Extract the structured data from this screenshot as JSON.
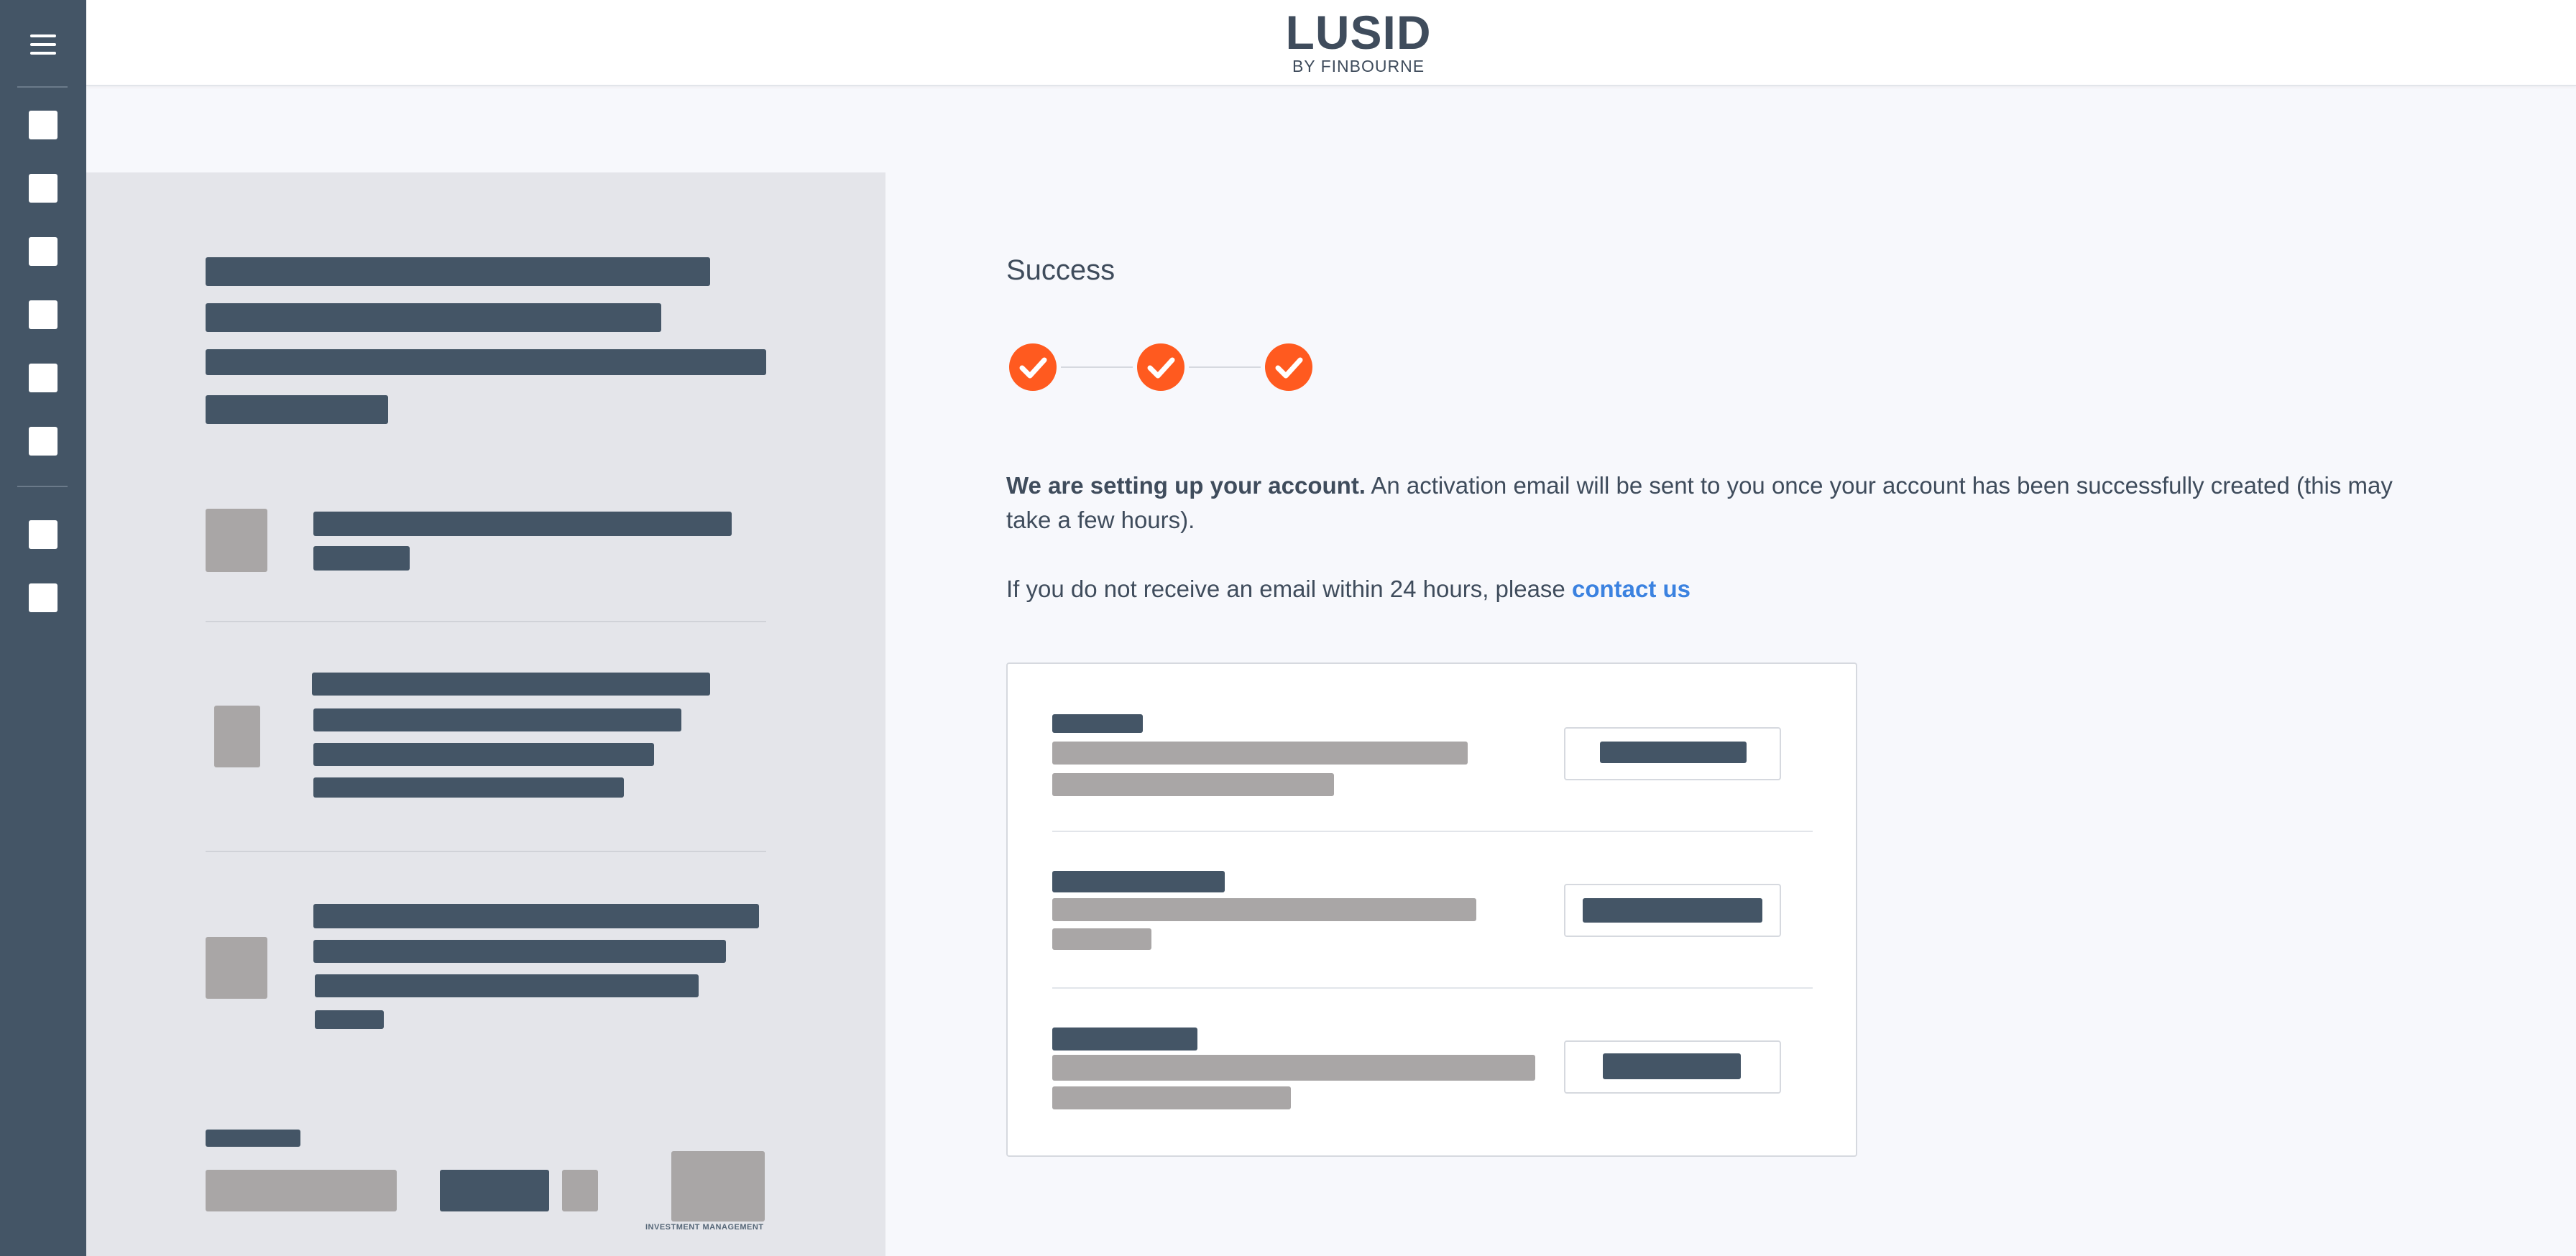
{
  "header": {
    "logo": "LUSID",
    "logo_sub": "BY FINBOURNE"
  },
  "sidebar": {
    "menu_icon": "hamburger-menu-icon",
    "items": [
      "nav-item-1",
      "nav-item-2",
      "nav-item-3",
      "nav-item-4",
      "nav-item-5",
      "nav-item-6",
      "nav-item-7",
      "nav-item-8"
    ]
  },
  "left_panel": {
    "footer_small_text": "INVESTMENT MANAGEMENT"
  },
  "main": {
    "title": "Success",
    "steps": [
      {
        "status": "complete",
        "icon": "check-icon"
      },
      {
        "status": "complete",
        "icon": "check-icon"
      },
      {
        "status": "complete",
        "icon": "check-icon"
      }
    ],
    "message_bold": "We are setting up your account.",
    "message_rest": " An activation email will be sent to you once your account has been successfully created (this may take a few hours).",
    "contact_prefix": "If you do not receive an email within 24 hours, please ",
    "contact_link": "contact us"
  },
  "colors": {
    "sidebar": "#445566",
    "accent": "#ff5a1f",
    "link": "#3b82e0",
    "text": "#3f4c5c",
    "placeholder_dark": "#445566",
    "placeholder_grey": "#a9a6a6"
  }
}
